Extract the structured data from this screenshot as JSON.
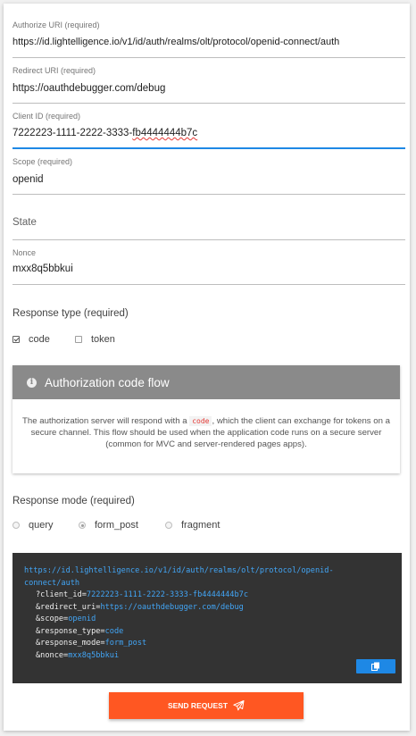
{
  "fields": {
    "authorize_uri": {
      "label": "Authorize URI (required)",
      "value": "https://id.lightelligence.io/v1/id/auth/realms/olt/protocol/openid-connect/auth"
    },
    "redirect_uri": {
      "label": "Redirect URI (required)",
      "value": "https://oauthdebugger.com/debug"
    },
    "client_id": {
      "label": "Client ID (required)",
      "value_prefix": "7222223-1111-2222-3333-",
      "value_suffix": "fb4444444b7c"
    },
    "scope": {
      "label": "Scope (required)",
      "value": "openid"
    },
    "state": {
      "placeholder": "State"
    },
    "nonce": {
      "label": "Nonce",
      "value": "mxx8q5bbkui"
    }
  },
  "response_type": {
    "label": "Response type (required)",
    "options": [
      {
        "label": "code",
        "checked": true
      },
      {
        "label": "token",
        "checked": false
      }
    ]
  },
  "flow_box": {
    "title": "Authorization code flow",
    "text_before": "The authorization server will respond with a",
    "code": "code",
    "text_after": ", which the client can exchange for tokens on a secure channel. This flow should be used when the application code runs on a secure server (common for MVC and server-rendered pages apps)."
  },
  "response_mode": {
    "label": "Response mode (required)",
    "options": [
      {
        "label": "query",
        "checked": false
      },
      {
        "label": "form_post",
        "checked": true
      },
      {
        "label": "fragment",
        "checked": false
      }
    ]
  },
  "request_preview": {
    "url_line1": "https://id.lightelligence.io/v1/id/auth/realms/olt/protocol/openid-",
    "url_line2": "connect/auth",
    "params": [
      {
        "key": "?client_id=",
        "value": "7222223-1111-2222-3333-fb4444444b7c"
      },
      {
        "key": "&redirect_uri=",
        "value": "https://oauthdebugger.com/debug"
      },
      {
        "key": "&scope=",
        "value": "openid"
      },
      {
        "key": "&response_type=",
        "value": "code"
      },
      {
        "key": "&response_mode=",
        "value": "form_post"
      },
      {
        "key": "&nonce=",
        "value": "mxx8q5bbkui"
      }
    ]
  },
  "send_button": {
    "label": "SEND REQUEST",
    "icon": "paper-plane-icon"
  },
  "copy_button": {
    "icon": "copy-icon"
  },
  "colors": {
    "accent": "#ff5722",
    "focus": "#1e88e5",
    "code_bg": "#333333",
    "code_value": "#42a5f5",
    "flow_header": "#8a8a8a"
  }
}
